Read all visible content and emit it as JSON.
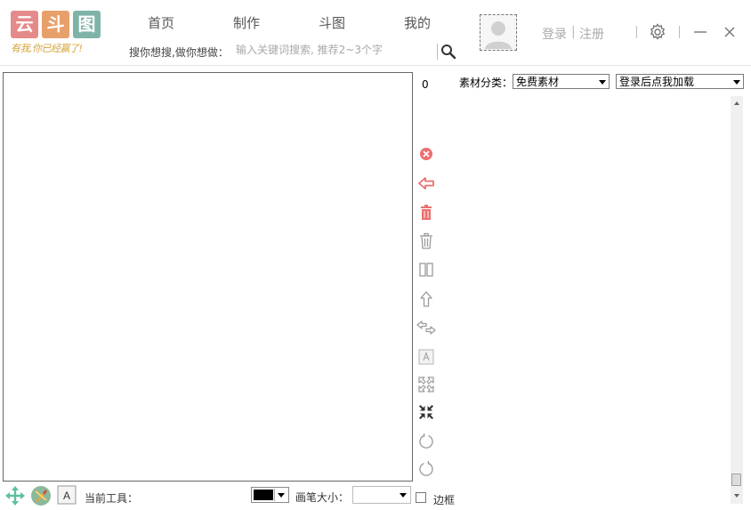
{
  "logo": {
    "chars": [
      "云",
      "斗",
      "图"
    ],
    "char_colors": [
      "#e58a8a",
      "#e8a06a",
      "#7fb3a8"
    ],
    "slogan": "有我,你已经赢了!"
  },
  "nav": {
    "items": [
      {
        "label": "首页"
      },
      {
        "label": "制作"
      },
      {
        "label": "斗图"
      },
      {
        "label": "我的"
      }
    ]
  },
  "search": {
    "label": "搜你想搜,做你想做：",
    "placeholder": "输入关键词搜索, 推荐2~3个字",
    "icon": "search-icon"
  },
  "auth": {
    "login": "登录",
    "separator": "|",
    "register": "注册"
  },
  "window_icons": [
    "gear-icon",
    "minimize-icon",
    "close-icon"
  ],
  "editor": {
    "counter": "0",
    "tools": [
      "delete-circle-icon",
      "undo-arrow-icon",
      "trash-red-icon",
      "trash-icon",
      "split-columns-icon",
      "move-up-icon",
      "flip-horizontal-icon",
      "text-a-icon",
      "expand-icon",
      "compress-icon",
      "rotate-clockwise-icon",
      "rotate-counterclockwise-icon"
    ]
  },
  "material": {
    "category_label": "素材分类：",
    "category_value": "免费素材",
    "load_value": "登录后点我加载"
  },
  "bottom": {
    "tools": [
      "move-tool-icon",
      "brush-tool-icon",
      "text-tool-icon"
    ],
    "text_tool_glyph": "A",
    "current_tool_label": "当前工具：",
    "color_value": "#000000",
    "brush_size_label": "画笔大小：",
    "brush_size_value": "",
    "border_label": "边框",
    "border_checked": false
  },
  "colors": {
    "accent_red": "#ec6f6f",
    "icon_gray": "#9a9a9a",
    "slogan": "#d6a43a"
  }
}
